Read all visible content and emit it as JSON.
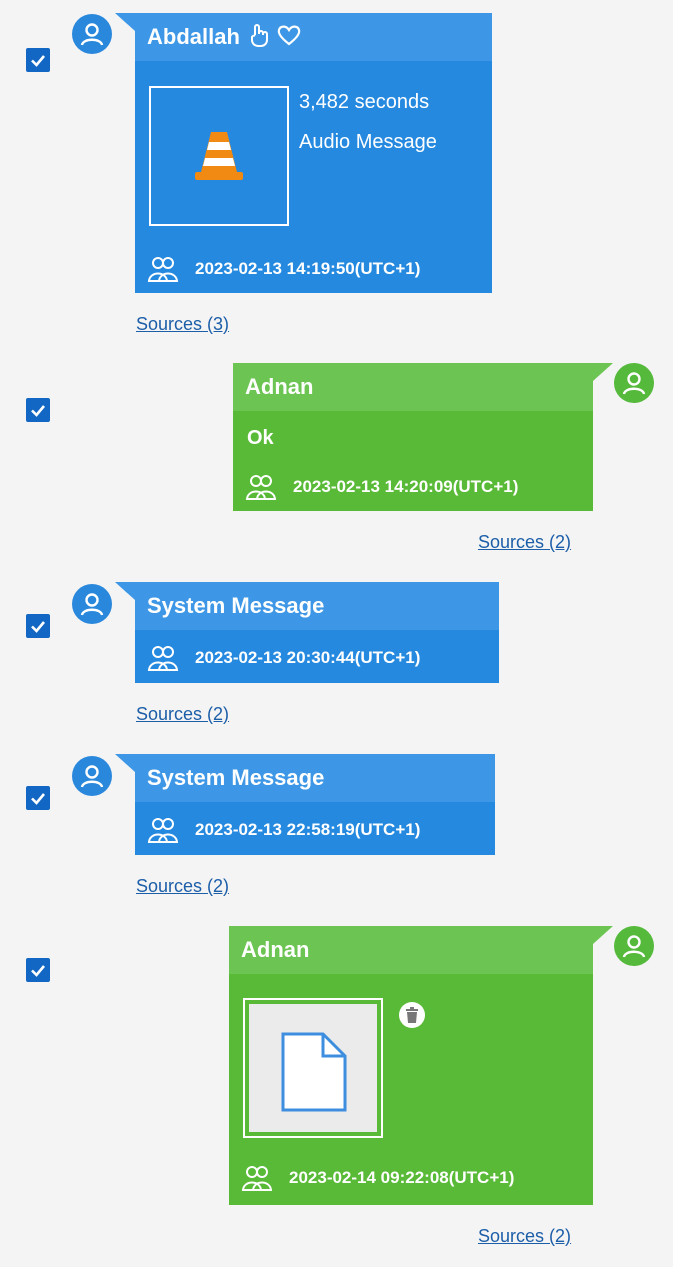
{
  "messages": [
    {
      "sender": "Abdallah",
      "duration": "3,482 seconds",
      "attachment_type": "Audio Message",
      "attachment_icon": "vlc-cone-icon",
      "reaction_icons": [
        "hand-icon",
        "heart-outline-icon"
      ],
      "timestamp": "2023-02-13 14:19:50(UTC+1)",
      "sources": "Sources (3)",
      "checked": true
    },
    {
      "sender": "Adnan",
      "body": "Ok",
      "timestamp": "2023-02-13 14:20:09(UTC+1)",
      "sources": "Sources (2)",
      "checked": true
    },
    {
      "sender": "System Message",
      "timestamp": "2023-02-13 20:30:44(UTC+1)",
      "sources": "Sources (2)",
      "checked": true
    },
    {
      "sender": "System Message",
      "timestamp": "2023-02-13 22:58:19(UTC+1)",
      "sources": "Sources (2)",
      "checked": true
    },
    {
      "sender": "Adnan",
      "attachment_icon": "file-icon",
      "status_icon": "deleted-trash-icon",
      "timestamp": "2023-02-14 09:22:08(UTC+1)",
      "sources": "Sources (2)",
      "checked": true
    }
  ],
  "colors": {
    "incoming": "#2589e0",
    "outgoing": "#58ba36",
    "checkbox": "#1367c4",
    "link": "#1c5ea8"
  }
}
